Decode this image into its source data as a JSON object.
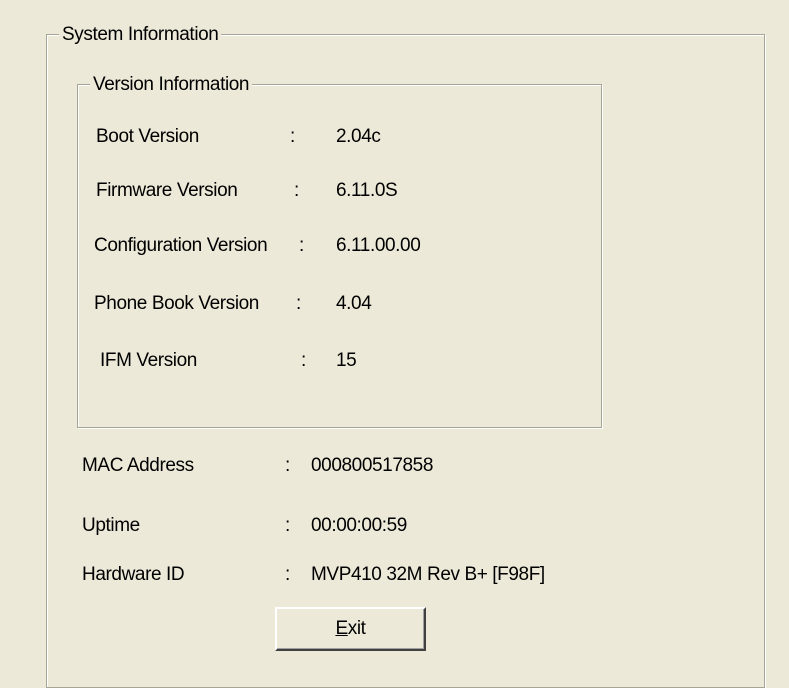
{
  "system_info": {
    "title": "System Information",
    "version_info": {
      "title": "Version Information",
      "rows": [
        {
          "label": "Boot Version",
          "sep": ":",
          "value": "2.04c"
        },
        {
          "label": "Firmware Version",
          "sep": ":",
          "value": "6.11.0S"
        },
        {
          "label": "Configuration Version",
          "sep": ":",
          "value": "6.11.00.00"
        },
        {
          "label": "Phone Book Version",
          "sep": ":",
          "value": "4.04"
        },
        {
          "label": "IFM Version",
          "sep": ":",
          "value": "15"
        }
      ]
    },
    "rows": [
      {
        "label": "MAC Address",
        "sep": ":",
        "value": "000800517858"
      },
      {
        "label": "Uptime",
        "sep": ":",
        "value": "00:00:00:59"
      },
      {
        "label": "Hardware ID",
        "sep": ":",
        "value": "MVP410 32M Rev B+ [F98F]"
      }
    ]
  },
  "exit_button": {
    "mnemonic": "E",
    "rest": "xit"
  }
}
